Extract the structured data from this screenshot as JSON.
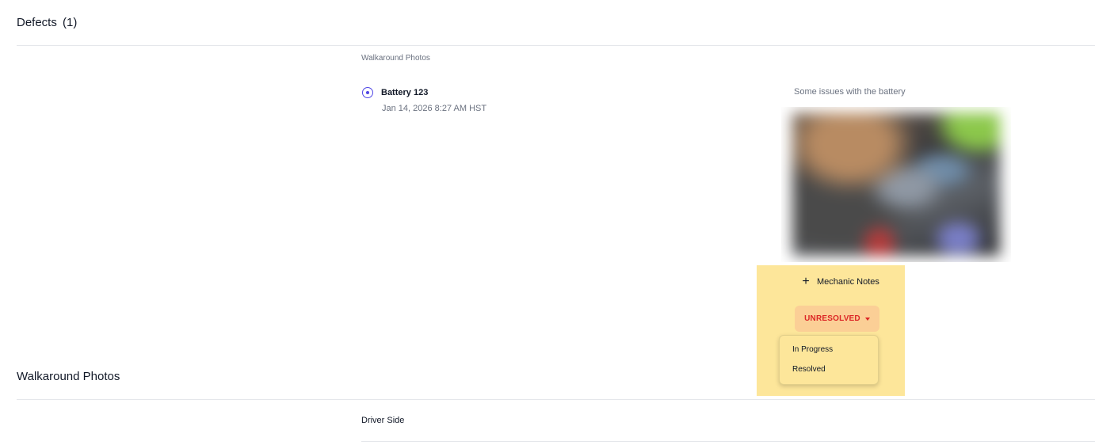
{
  "defects": {
    "title": "Defects",
    "count": "(1)",
    "source_label": "Walkaround Photos",
    "item": {
      "icon": "radio-target-icon",
      "name": "Battery 123",
      "date": "Jan 14, 2026 8:27 AM HST",
      "description": "Some issues with the battery",
      "photo_alt": "battery-photo",
      "mechanic_notes_label": "Mechanic Notes",
      "status": {
        "current": "UNRESOLVED",
        "color": "#dc2626",
        "options": [
          "In Progress",
          "Resolved"
        ]
      }
    }
  },
  "walkaround": {
    "title": "Walkaround Photos",
    "first_item_label": "Driver Side"
  },
  "colors": {
    "accent": "#4f46e5",
    "highlight": "#fde69a",
    "status_bg": "#fbcf96"
  }
}
